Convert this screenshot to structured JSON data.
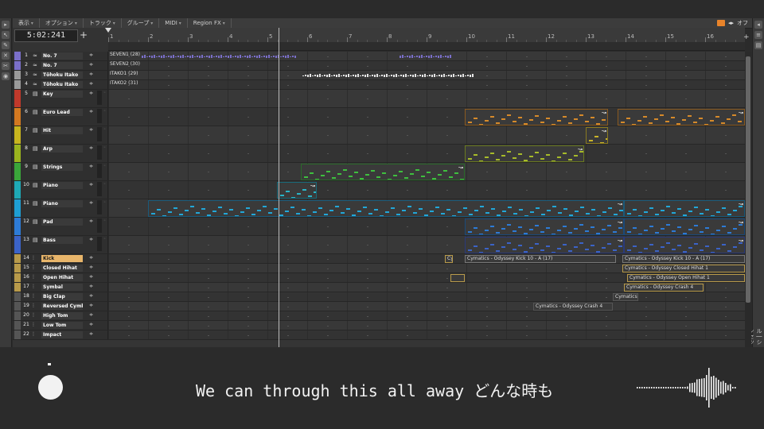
{
  "menus": [
    "表示",
    "オプション",
    "トラック",
    "グループ",
    "MIDI",
    "Region FX"
  ],
  "menu_right_label": "オフ",
  "time_display": "5:02:241",
  "add_button": "+",
  "ruler_numbers": [
    "1",
    "2",
    "3",
    "4",
    "5",
    "6",
    "7",
    "8",
    "9",
    "10",
    "11",
    "12",
    "13",
    "14",
    "15",
    "16"
  ],
  "ruler_plus": "+",
  "vocal_clips": [
    "SEVEN1 (28)",
    "SEVEN2 (30)",
    "ITAKO1 (29)",
    "ITAKO2 (31)"
  ],
  "right_strip_label": "ル | シンセック",
  "tracks": [
    {
      "num": "1",
      "name": "No. 7",
      "icon": "audio-wave-icon",
      "color": "#7a6fc9"
    },
    {
      "num": "2",
      "name": "No. 7",
      "icon": "audio-wave-icon",
      "color": "#7a6fc9"
    },
    {
      "num": "3",
      "name": "Tōhoku Itako",
      "icon": "audio-wave-icon",
      "color": "#9a9a9a"
    },
    {
      "num": "4",
      "name": "Tōhoku Itako",
      "icon": "audio-wave-icon",
      "color": "#9a9a9a"
    },
    {
      "num": "5",
      "name": "Key",
      "icon": "midi-icon",
      "color": "#c0392b"
    },
    {
      "num": "6",
      "name": "Euro Lead",
      "icon": "midi-icon",
      "color": "#d37820"
    },
    {
      "num": "7",
      "name": "Hit",
      "icon": "midi-icon",
      "color": "#c7b41e"
    },
    {
      "num": "8",
      "name": "Arp",
      "icon": "midi-icon",
      "color": "#9ab31e"
    },
    {
      "num": "9",
      "name": "Strings",
      "icon": "midi-icon",
      "color": "#3aa53a"
    },
    {
      "num": "10",
      "name": "Piano",
      "icon": "midi-icon",
      "color": "#1ea9b5"
    },
    {
      "num": "11",
      "name": "Piano",
      "icon": "midi-icon",
      "color": "#1e9ed3"
    },
    {
      "num": "12",
      "name": "Pad",
      "icon": "midi-icon",
      "color": "#2d7bd6"
    },
    {
      "num": "13",
      "name": "Bass",
      "icon": "midi-icon",
      "color": "#3b63c7"
    },
    {
      "num": "14",
      "name": "Kick",
      "icon": "sliders-icon",
      "color": "#b89a4a"
    },
    {
      "num": "15",
      "name": "Closed Hihat",
      "icon": "sliders-icon",
      "color": "#b89a4a"
    },
    {
      "num": "16",
      "name": "Open Hihat",
      "icon": "sliders-icon",
      "color": "#b89a4a"
    },
    {
      "num": "17",
      "name": "Symbal",
      "icon": "sliders-icon",
      "color": "#b89a4a"
    },
    {
      "num": "18",
      "name": "Big Clap",
      "icon": "sliders-icon",
      "color": "#555"
    },
    {
      "num": "19",
      "name": "Reversed Cymbal",
      "icon": "sliders-icon",
      "color": "#555"
    },
    {
      "num": "20",
      "name": "High Tom",
      "icon": "sliders-icon",
      "color": "#555"
    },
    {
      "num": "21",
      "name": "Low Tom",
      "icon": "sliders-icon",
      "color": "#555"
    },
    {
      "num": "22",
      "name": "Impact",
      "icon": "sliders-icon",
      "color": "#555"
    }
  ],
  "drum_clips": {
    "kick_a": "Cy",
    "kick_b": "Cymatics - Odyssey Kick 10 - A (17)",
    "kick_c": "Cymatics - Odyssey Kick 10 - A (17)",
    "closed_hihat": "Cymatics - Odyssey Closed Hihat 1",
    "open_hihat": "Cymatics - Odyssey Open Hihat 1",
    "symbal": "Cymatics - Odyssey Crash 4",
    "big_clap": "Cymatics",
    "reversed_cymbal": "Cymatics - Odyssey Crash 4"
  },
  "lyric": "We can through this all away どんな時も",
  "colors": {
    "accent": "#e8832a",
    "playhead": "#bbbbbb"
  }
}
